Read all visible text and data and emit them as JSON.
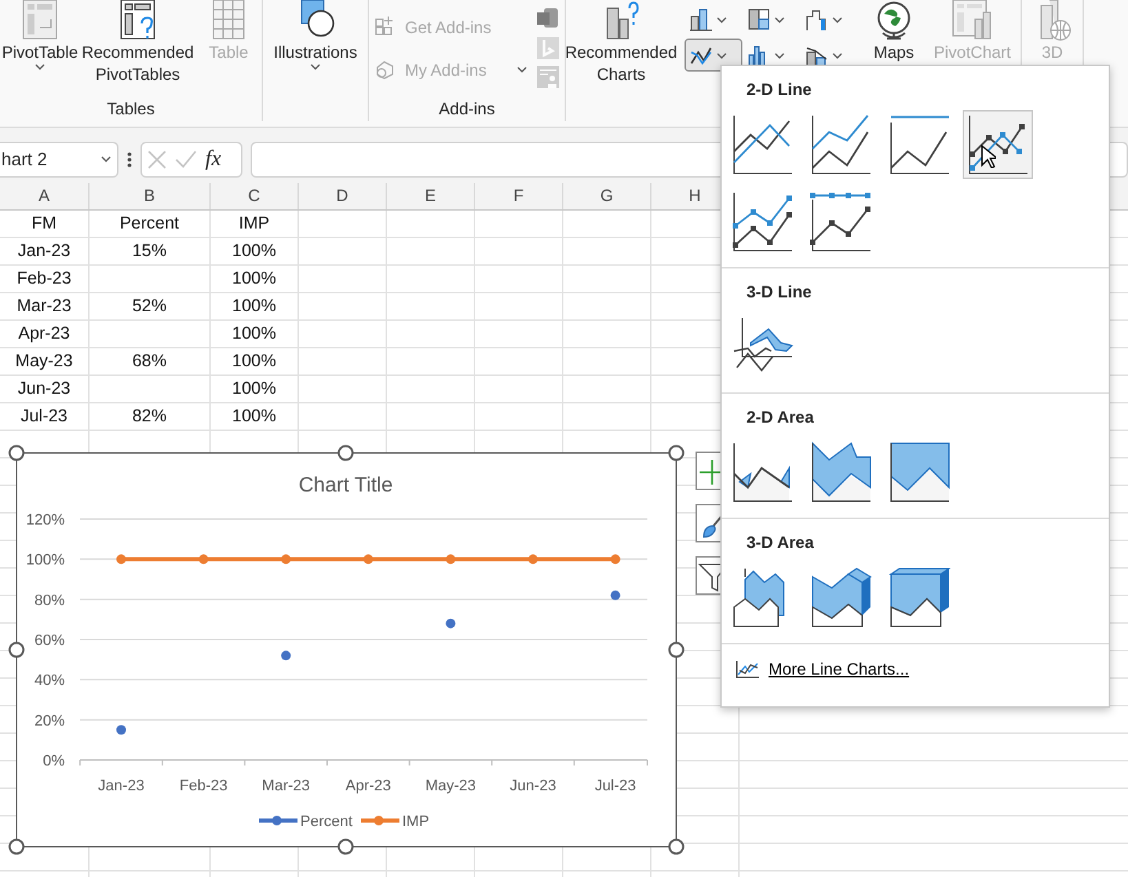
{
  "ribbon": {
    "groups": [
      {
        "label": "Tables",
        "buttons": [
          {
            "kind": "large",
            "label": "PivotTable",
            "dropdown": true,
            "disabled": false
          },
          {
            "kind": "large",
            "label": "Recommended PivotTables",
            "dropdown": false,
            "disabled": false
          },
          {
            "kind": "large",
            "label": "Table",
            "dropdown": false,
            "disabled": true
          }
        ]
      },
      {
        "buttons": [
          {
            "kind": "large",
            "label": "Illustrations",
            "dropdown": true,
            "disabled": false
          }
        ]
      },
      {
        "label": "Add-ins",
        "buttons": [
          {
            "kind": "small",
            "label": "Get Add-ins",
            "dropdown": false,
            "disabled": true
          },
          {
            "kind": "small",
            "label": "My Add-ins",
            "dropdown": true,
            "disabled": true
          },
          {
            "kind": "icon",
            "disabled": false
          },
          {
            "kind": "icon",
            "disabled": true
          },
          {
            "kind": "icon",
            "disabled": true
          }
        ]
      },
      {
        "buttons": [
          {
            "kind": "large",
            "label": "Recommended Charts",
            "dropdown": false,
            "disabled": false
          },
          {
            "kind": "chart-menu",
            "pressed": false
          },
          {
            "kind": "chart-menu",
            "pressed": false
          },
          {
            "kind": "chart-menu",
            "pressed": false
          },
          {
            "kind": "chart-menu",
            "pressed": true
          },
          {
            "kind": "chart-menu",
            "pressed": false
          },
          {
            "kind": "chart-menu",
            "pressed": false
          },
          {
            "kind": "large",
            "label": "Maps",
            "dropdown": false,
            "disabled": false
          },
          {
            "kind": "large",
            "label": "PivotChart",
            "dropdown": false,
            "disabled": true
          }
        ]
      },
      {
        "buttons": [
          {
            "kind": "large",
            "label": "3D",
            "dropdown": false,
            "disabled": true
          }
        ]
      }
    ]
  },
  "formula_bar": {
    "name_box": "hart 2",
    "function_label": "fx"
  },
  "sheet": {
    "columns": [
      "A",
      "B",
      "C",
      "D",
      "E",
      "F",
      "G",
      "H"
    ],
    "rows": [
      [
        "FM",
        "Percent",
        "IMP"
      ],
      [
        "Jan-23",
        "15%",
        "100%"
      ],
      [
        "Feb-23",
        null,
        "100%"
      ],
      [
        "Mar-23",
        "52%",
        "100%"
      ],
      [
        "Apr-23",
        null,
        "100%"
      ],
      [
        "May-23",
        "68%",
        "100%"
      ],
      [
        "Jun-23",
        null,
        "100%"
      ],
      [
        "Jul-23",
        "82%",
        "100%"
      ]
    ]
  },
  "chart": {
    "chart_data": {
      "type": "line",
      "title": "Chart Title",
      "categories": [
        "Jan-23",
        "Feb-23",
        "Mar-23",
        "Apr-23",
        "May-23",
        "Jun-23",
        "Jul-23"
      ],
      "grid": true,
      "legend": "bottom",
      "series": [
        {
          "name": "Percent",
          "type": "scatter",
          "marker": true,
          "color": "#4472c4",
          "values": [
            0.15,
            null,
            0.52,
            null,
            0.68,
            null,
            0.82
          ]
        },
        {
          "name": "IMP",
          "marker": true,
          "color": "#ed7d31",
          "values": [
            1,
            1,
            1,
            1,
            1,
            1,
            1
          ]
        }
      ],
      "ylim": [
        0,
        1.2
      ],
      "yticks": [
        {
          "value": 0,
          "label": "0%"
        },
        {
          "value": 0.2,
          "label": "20%"
        },
        {
          "value": 0.4,
          "label": "40%"
        },
        {
          "value": 0.6,
          "label": "60%"
        },
        {
          "value": 0.8,
          "label": "80%"
        },
        {
          "value": 1,
          "label": "100%"
        },
        {
          "value": 1.2,
          "label": "120%"
        }
      ]
    }
  },
  "chart_gallery": {
    "sections": [
      {
        "title": "2-D Line",
        "options": [
          {
            "selected": false
          },
          {
            "selected": false
          },
          {
            "selected": false
          },
          {
            "selected": true
          },
          {
            "selected": false
          },
          {
            "selected": false
          }
        ]
      },
      {
        "title": "3-D Line",
        "options": [
          {
            "selected": false
          }
        ]
      },
      {
        "title": "2-D Area",
        "options": [
          {
            "selected": false
          },
          {
            "selected": false
          },
          {
            "selected": false
          }
        ]
      },
      {
        "title": "3-D Area",
        "options": [
          {
            "selected": false
          },
          {
            "selected": false
          },
          {
            "selected": false
          }
        ]
      }
    ],
    "footer": {
      "label": "More Line Charts..."
    }
  }
}
